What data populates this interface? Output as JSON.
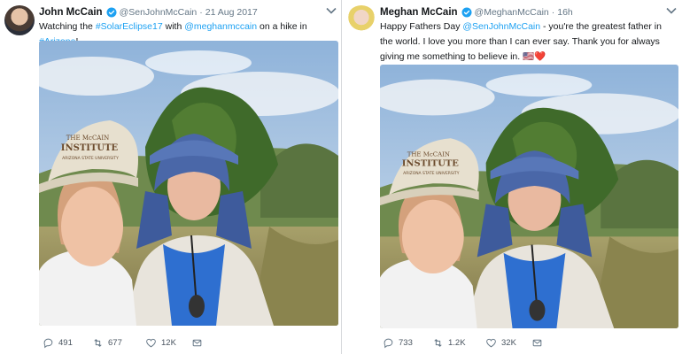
{
  "tweets": [
    {
      "author_name": "John McCain",
      "handle": "@SenJohnMcCain",
      "separator": "·",
      "date": "21 Aug 2017",
      "text_pre": "Watching the ",
      "link_1": "#SolarEclipse17",
      "text_mid": " with ",
      "link_2": "@meghanmccain",
      "text_mid2": " on a hike in ",
      "link_3": "#Arizona",
      "text_post": "!",
      "replies": "491",
      "retweets": "677",
      "likes": "12K",
      "hat_text_1": "THE McCAIN",
      "hat_text_2": "INSTITUTE",
      "hat_text_3": "ARIZONA STATE UNIVERSITY"
    },
    {
      "author_name": "Meghan McCain",
      "handle": "@MeghanMcCain",
      "separator": "·",
      "date": "16h",
      "text_pre": "Happy Fathers Day ",
      "link_1": "@SenJohnMcCain",
      "text_post": " - you're the greatest father in the world. I love you more than I can ever say. Thank you for always giving me something to believe in. 🇺🇸❤️",
      "replies": "733",
      "retweets": "1.2K",
      "likes": "32K",
      "hat_text_1": "THE McCAIN",
      "hat_text_2": "INSTITUTE",
      "hat_text_3": "ARIZONA STATE UNIVERSITY"
    }
  ],
  "colors": {
    "link": "#1da1f2",
    "verified": "#1da1f2",
    "meta": "#657786",
    "sky": "#a9c6e6",
    "hat": "#e7e0cf",
    "blue_hat": "#4a6bb3"
  },
  "icons": [
    "reply-icon",
    "retweet-icon",
    "like-icon",
    "message-icon",
    "verified-icon",
    "chevron-down-icon"
  ]
}
